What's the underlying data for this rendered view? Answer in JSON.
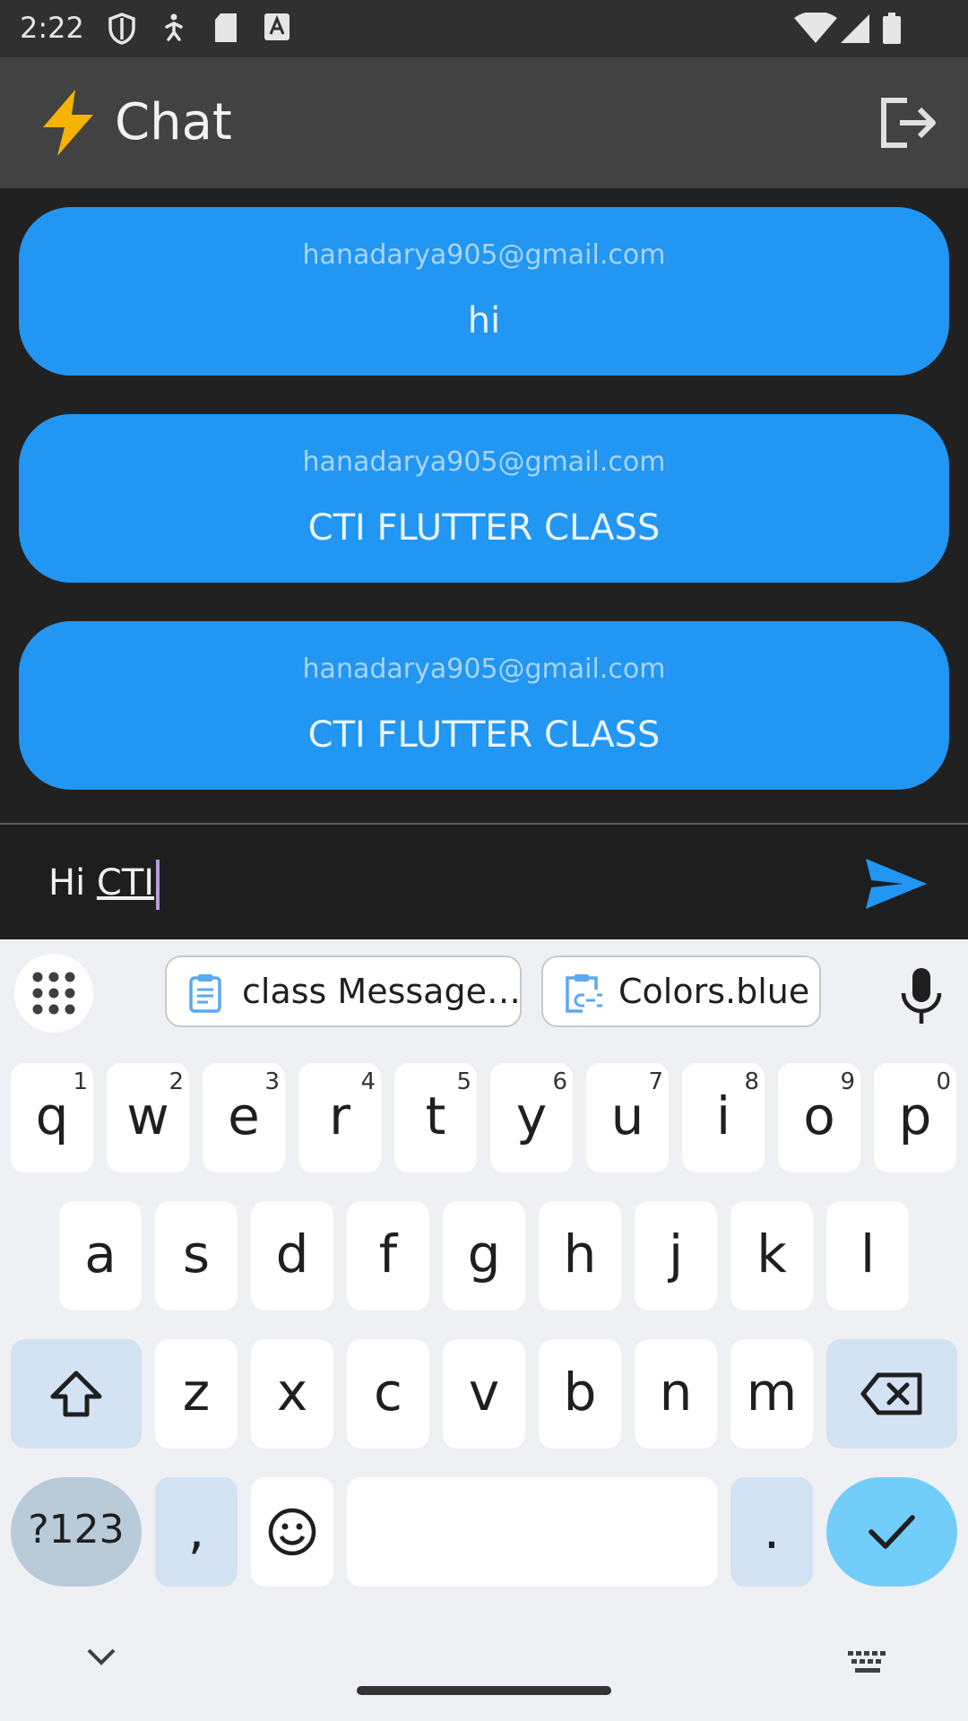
{
  "status_bar": {
    "time": "2:22"
  },
  "app_bar": {
    "title": "Chat",
    "icon": "bolt-icon",
    "action_icon": "logout-icon"
  },
  "messages": [
    {
      "sender": "hanadarya905@gmail.com",
      "text": "hi"
    },
    {
      "sender": "hanadarya905@gmail.com",
      "text": "CTI FLUTTER CLASS"
    },
    {
      "sender": "hanadarya905@gmail.com",
      "text": "CTI FLUTTER CLASS"
    }
  ],
  "composer": {
    "prefix": "Hi ",
    "composing": "CTI",
    "send_icon": "send-icon"
  },
  "keyboard": {
    "suggestions": [
      "class Message…",
      "Colors.blue"
    ],
    "row1": [
      {
        "key": "q",
        "hint": "1"
      },
      {
        "key": "w",
        "hint": "2"
      },
      {
        "key": "e",
        "hint": "3"
      },
      {
        "key": "r",
        "hint": "4"
      },
      {
        "key": "t",
        "hint": "5"
      },
      {
        "key": "y",
        "hint": "6"
      },
      {
        "key": "u",
        "hint": "7"
      },
      {
        "key": "i",
        "hint": "8"
      },
      {
        "key": "o",
        "hint": "9"
      },
      {
        "key": "p",
        "hint": "0"
      }
    ],
    "row2": [
      "a",
      "s",
      "d",
      "f",
      "g",
      "h",
      "j",
      "k",
      "l"
    ],
    "row3": [
      "z",
      "x",
      "c",
      "v",
      "b",
      "n",
      "m"
    ],
    "symbols_label": "?123",
    "comma": ",",
    "period": "."
  },
  "colors": {
    "bubble": "#2196f3",
    "app_bar": "#424242",
    "background": "#212121",
    "send": "#2196f3",
    "enter_key": "#72cdfb"
  }
}
